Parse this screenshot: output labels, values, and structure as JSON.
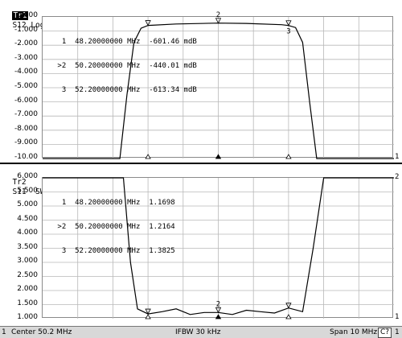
{
  "trace1": {
    "tag": "Tr1",
    "header": "S12 Log Mag 1.000dB/ Ref 0.000dB [RT]",
    "y_ticks": [
      "0.000",
      "-1.000",
      "-2.000",
      "-3.000",
      "-4.000",
      "-5.000",
      "-6.000",
      "-7.000",
      "-8.000",
      "-9.000",
      "-10.00"
    ],
    "markers": [
      {
        "row": "  1  48.20000000 MHz  -601.46 mdB"
      },
      {
        "row": " >2  50.20000000 MHz  -440.01 mdB"
      },
      {
        "row": "  3  52.20000000 MHz  -613.34 mdB"
      }
    ],
    "marker_flag_2": "2",
    "marker_flag_3": "3",
    "right_num": "1"
  },
  "trace2": {
    "tag": "Tr2",
    "header": "S11  SWR 500.0m/ Ref 1.000 [F1]",
    "y_ticks": [
      "6.000",
      "5.500",
      "5.000",
      "4.500",
      "4.000",
      "3.500",
      "3.000",
      "2.500",
      "2.000",
      "1.500",
      "1.000"
    ],
    "markers": [
      {
        "row": "  1  48.20000000 MHz  1.1698"
      },
      {
        "row": " >2  50.20000000 MHz  1.2164"
      },
      {
        "row": "  3  52.20000000 MHz  1.3825"
      }
    ],
    "marker_flag_2": "2",
    "right_num_top": "2",
    "right_num_bottom": "1"
  },
  "status": {
    "channel": "1",
    "center": "Center 50.2 MHz",
    "ifbw": "IFBW 30 kHz",
    "span": "Span 10 MHz",
    "c7": "C?",
    "end": "1"
  },
  "chart_data": [
    {
      "type": "line",
      "title": "S12 Log Mag 1.000dB/ Ref 0.000dB [RT]",
      "x_units": "MHz",
      "xlim": [
        45.2,
        55.2
      ],
      "ylim": [
        -10,
        0
      ],
      "grid": true,
      "series": [
        {
          "x": [
            45.2,
            47.4,
            47.6,
            47.8,
            48.0,
            48.2,
            49.0,
            50.2,
            51.0,
            52.0,
            52.2,
            52.4,
            52.6,
            52.8,
            53.0,
            55.2
          ],
          "y": [
            -10,
            -10,
            -5.5,
            -1.8,
            -0.8,
            -0.6,
            -0.5,
            -0.44,
            -0.46,
            -0.55,
            -0.61,
            -0.75,
            -1.8,
            -6.0,
            -10,
            -10
          ]
        }
      ]
    },
    {
      "type": "line",
      "title": "S11 SWR 500.0m/ Ref 1.000 [F1]",
      "x_units": "MHz",
      "xlim": [
        45.2,
        55.2
      ],
      "ylim": [
        1.0,
        6.0
      ],
      "grid": true,
      "series": [
        {
          "x": [
            45.2,
            47.5,
            47.7,
            47.9,
            48.2,
            48.6,
            49.0,
            49.4,
            49.8,
            50.2,
            50.6,
            51.0,
            51.4,
            51.8,
            52.2,
            52.6,
            52.9,
            53.2,
            55.2
          ],
          "y": [
            6.0,
            6.0,
            3.0,
            1.35,
            1.17,
            1.25,
            1.35,
            1.15,
            1.22,
            1.22,
            1.15,
            1.3,
            1.25,
            1.2,
            1.38,
            1.25,
            3.5,
            6.0,
            6.0
          ]
        }
      ]
    }
  ]
}
